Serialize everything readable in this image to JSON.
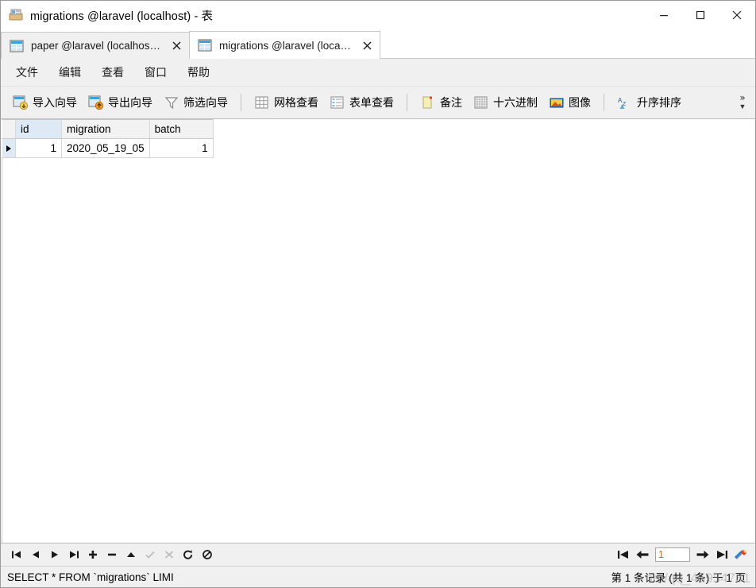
{
  "window": {
    "title": "migrations @laravel (localhost) - 表",
    "icon": "table-window-icon",
    "minimize_label": "—",
    "maximize_label": "▢",
    "close_label": "✕"
  },
  "tabs": [
    {
      "label": "paper @laravel (localhos…",
      "icon": "table-tab-icon",
      "close_label": "✕",
      "active": false
    },
    {
      "label": "migrations @laravel (loca…",
      "icon": "table-tab-icon",
      "close_label": "✕",
      "active": true
    }
  ],
  "menu": {
    "items": [
      {
        "label": "文件"
      },
      {
        "label": "编辑"
      },
      {
        "label": "查看"
      },
      {
        "label": "窗口"
      },
      {
        "label": "帮助"
      }
    ]
  },
  "toolbar": {
    "groups": [
      {
        "buttons": [
          {
            "label": "导入向导",
            "icon": "import-wizard-icon"
          },
          {
            "label": "导出向导",
            "icon": "export-wizard-icon"
          },
          {
            "label": "筛选向导",
            "icon": "filter-wizard-icon"
          }
        ]
      },
      {
        "buttons": [
          {
            "label": "网格查看",
            "icon": "grid-view-icon"
          },
          {
            "label": "表单查看",
            "icon": "form-view-icon"
          }
        ]
      },
      {
        "buttons": [
          {
            "label": "备注",
            "icon": "memo-icon"
          },
          {
            "label": "十六进制",
            "icon": "hex-icon"
          },
          {
            "label": "图像",
            "icon": "image-icon"
          }
        ]
      },
      {
        "buttons": [
          {
            "label": "升序排序",
            "icon": "sort-ascending-icon"
          }
        ]
      }
    ],
    "overflow_chevron": "»",
    "overflow_caret": "▼"
  },
  "grid": {
    "columns": [
      {
        "key": "id",
        "label": "id",
        "selected": true,
        "align": "right"
      },
      {
        "key": "migration",
        "label": "migration",
        "selected": false,
        "align": "left"
      },
      {
        "key": "batch",
        "label": "batch",
        "selected": false,
        "align": "right"
      }
    ],
    "rows": [
      {
        "marker": "▶",
        "id": "1",
        "migration": "2020_05_19_05",
        "batch": "1"
      }
    ]
  },
  "navigation": {
    "buttons": [
      {
        "name": "first-record",
        "glyph": "⏮",
        "enabled": true
      },
      {
        "name": "previous-record",
        "glyph": "◀",
        "enabled": true
      },
      {
        "name": "next-record",
        "glyph": "▶",
        "enabled": true
      },
      {
        "name": "last-record",
        "glyph": "⏭",
        "enabled": true
      },
      {
        "name": "add-record",
        "glyph": "+",
        "enabled": true
      },
      {
        "name": "delete-record",
        "glyph": "−",
        "enabled": true
      },
      {
        "name": "apply-change",
        "glyph": "▲",
        "enabled": true
      },
      {
        "name": "confirm-change",
        "glyph": "✓",
        "enabled": false
      },
      {
        "name": "cancel-change",
        "glyph": "✗",
        "enabled": false
      },
      {
        "name": "refresh",
        "glyph": "↻",
        "enabled": true
      },
      {
        "name": "stop",
        "glyph": "⊘",
        "enabled": true
      }
    ],
    "pager": {
      "first_page": "⇤",
      "previous_page": "←",
      "page_value": "1",
      "next_page": "→",
      "last_page": "⇥",
      "tools_icon": "tools-icon"
    }
  },
  "status": {
    "sql": "SELECT * FROM `migrations` LIMI",
    "records": "第 1 条记录 (共 1 条) 于 1 页",
    "watermark": "net/qq_45954781"
  }
}
